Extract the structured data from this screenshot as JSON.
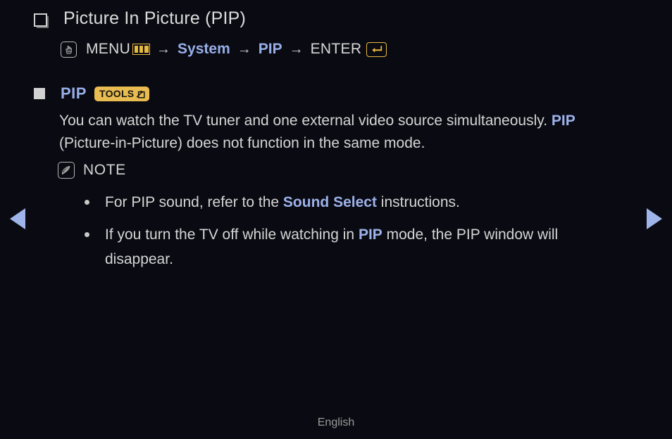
{
  "background_color": "#0a0a12",
  "accent_blue": "#97afe8",
  "accent_gold": "#e6b93f",
  "text_color": "#d5d5d5",
  "title": {
    "marker_icon": "hollow-square-marker",
    "text": "Picture In Picture (PIP)"
  },
  "menu_path": {
    "press_icon": "hand-press-icon",
    "menu_word": "MENU",
    "menu_icon": "menu-bars-icon",
    "arrow1": "→",
    "system": "System",
    "arrow2": "→",
    "pip": "PIP",
    "arrow3": "→",
    "enter_word": "ENTER",
    "enter_icon": "enter-key-icon"
  },
  "section": {
    "marker_icon": "solid-square-marker",
    "label": "PIP",
    "badge": {
      "text": "TOOLS",
      "icon": "tools-arrow-box-icon"
    }
  },
  "paragraph": {
    "part1": "You can watch the TV tuner and one external video source simultaneously. ",
    "highlight1": "PIP",
    "part2": " (Picture-in-Picture) does not function in the same mode."
  },
  "note": {
    "icon": "note-pen-icon",
    "label": "NOTE",
    "bullets": [
      {
        "part1": "For PIP sound, refer to the ",
        "highlight": "Sound Select",
        "part2": " instructions."
      },
      {
        "part1": "If you turn the TV off while watching in ",
        "highlight": "PIP",
        "part2": " mode, the PIP window will disappear."
      }
    ]
  },
  "nav": {
    "prev_icon": "triangle-left-icon",
    "next_icon": "triangle-right-icon"
  },
  "footer": {
    "language": "English"
  }
}
